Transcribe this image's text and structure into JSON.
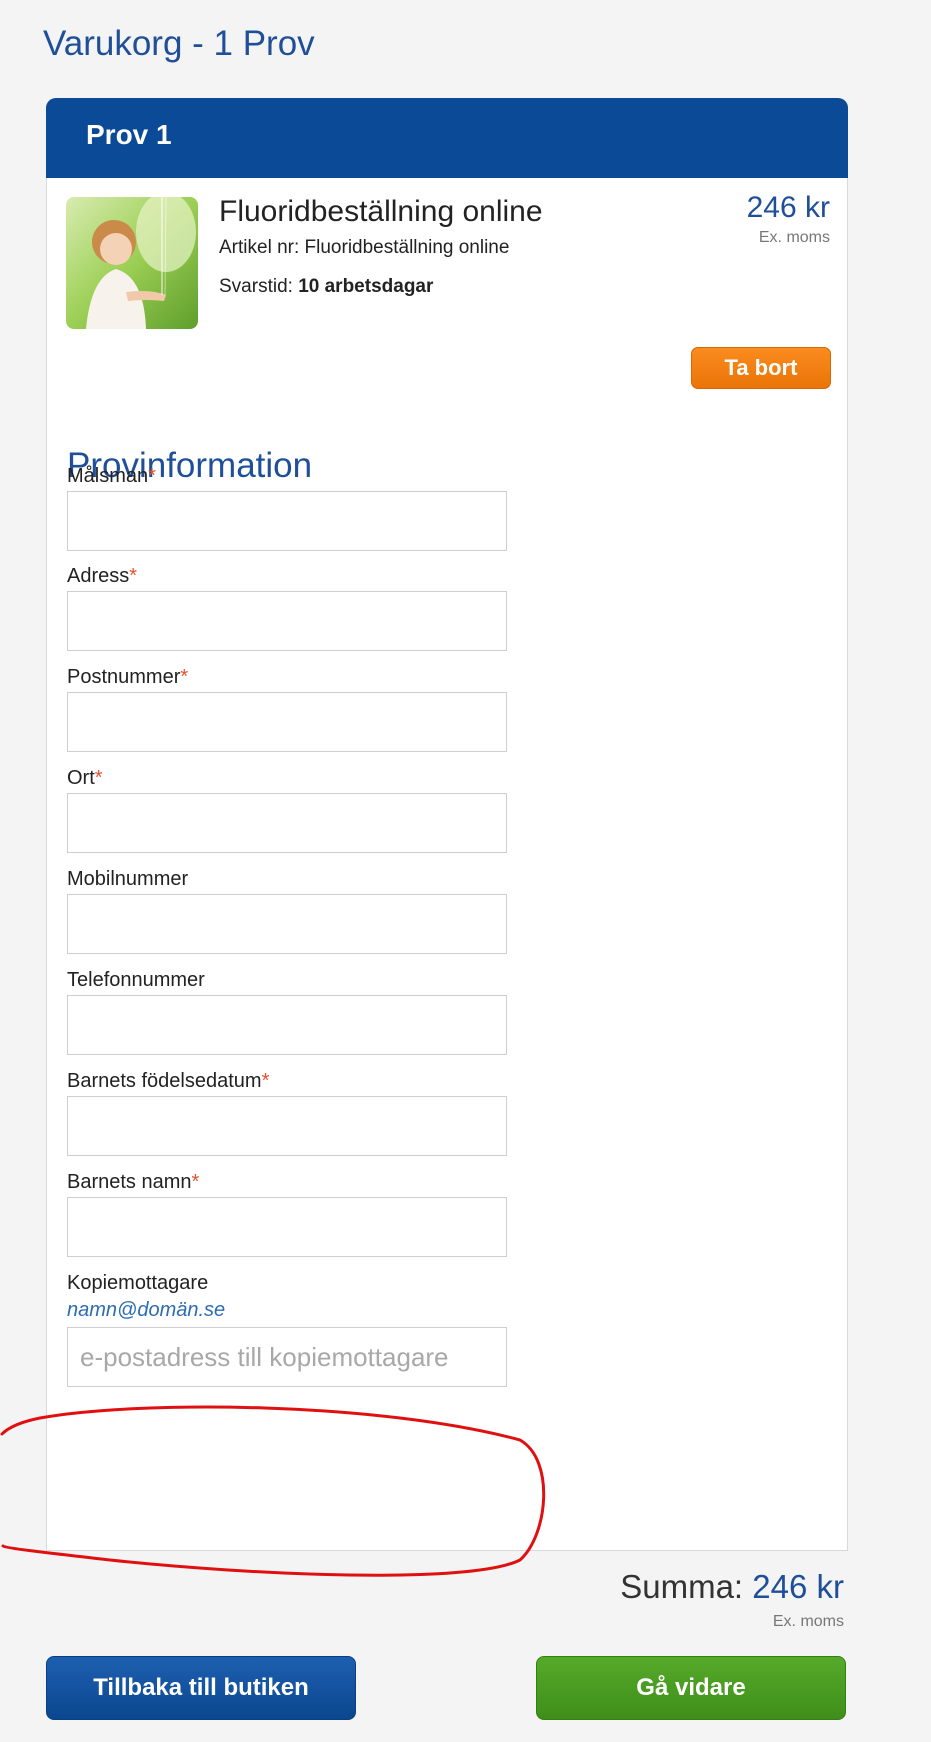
{
  "cart": {
    "title": "Varukorg - 1 Prov"
  },
  "sample": {
    "header": "Prov 1",
    "product_name": "Fluoridbeställning online",
    "article_label": "Artikel nr:",
    "article_value": "Fluoridbeställning online",
    "response_label": "Svarstid:",
    "response_value": "10 arbetsdagar",
    "price": "246 kr",
    "price_note": "Ex. moms",
    "remove_label": "Ta bort"
  },
  "form": {
    "heading": "Provinformation",
    "fields": [
      {
        "label": "Målsman",
        "required": "*",
        "value": ""
      },
      {
        "label": "Adress",
        "required": "*",
        "value": ""
      },
      {
        "label": "Postnummer",
        "required": "*",
        "value": ""
      },
      {
        "label": "Ort",
        "required": "*",
        "value": ""
      },
      {
        "label": "Mobilnummer",
        "required": "",
        "value": ""
      },
      {
        "label": "Telefonnummer",
        "required": "",
        "value": ""
      },
      {
        "label": "Barnets födelsedatum",
        "required": "*",
        "value": ""
      },
      {
        "label": "Barnets namn",
        "required": "*",
        "value": ""
      }
    ],
    "copy_label": "Kopiemottagare",
    "copy_hint": "namn@domän.se",
    "copy_placeholder": "e-postadress till kopiemottagare",
    "copy_value": ""
  },
  "summary": {
    "label": "Summa:",
    "amount": "246 kr",
    "note": "Ex. moms"
  },
  "actions": {
    "back_label": "Tillbaka till butiken",
    "next_label": "Gå vidare"
  },
  "colors": {
    "brand_blue": "#0b4a96",
    "accent_orange": "#f07f12",
    "go_green": "#4c9d22",
    "annotation_red": "#e01010"
  }
}
